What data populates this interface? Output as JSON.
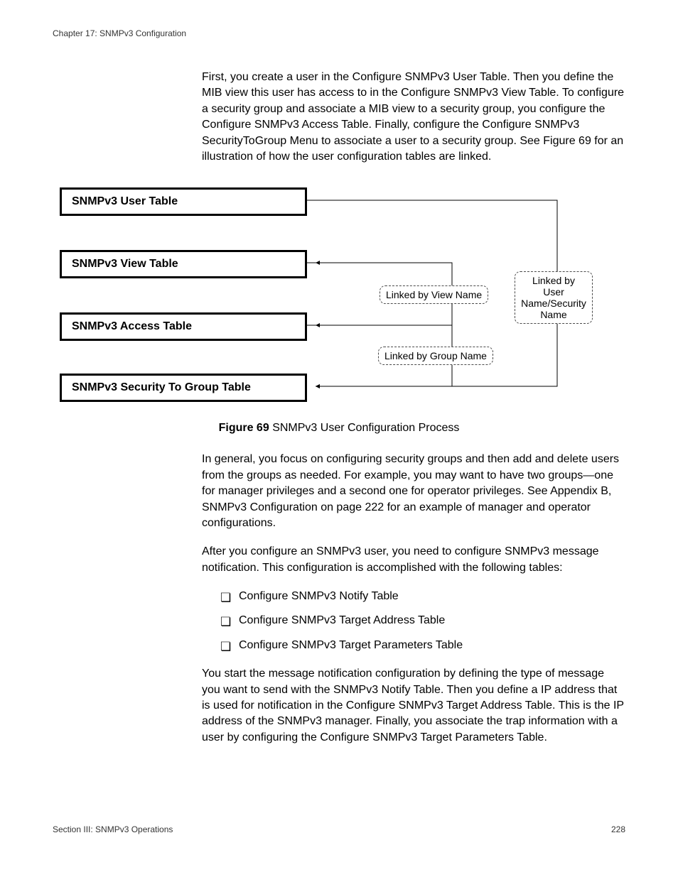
{
  "header": {
    "chapter": "Chapter 17: SNMPv3 Configuration"
  },
  "para1": "First, you create a user in the Configure SNMPv3 User Table. Then you define the MIB view this user has access to in the Configure SNMPv3 View Table. To configure a security group and associate a MIB view to a security group, you configure the Configure SNMPv3 Access Table. Finally, configure the Configure SNMPv3 SecurityToGroup Menu to associate a user to a security group. See Figure 69 for an illustration of how the user configuration tables are linked.",
  "diagram": {
    "tables": {
      "user": "SNMPv3 User Table",
      "view": "SNMPv3 View Table",
      "access": "SNMPv3 Access Table",
      "s2g": "SNMPv3 Security To Group Table"
    },
    "links": {
      "view_name": "Linked by View Name",
      "group_name": "Linked by Group Name",
      "user_sec": "Linked by User Name/Security Name"
    }
  },
  "figure": {
    "label": "Figure 69",
    "caption": "SNMPv3 User Configuration Process"
  },
  "para2": "In general, you focus on configuring security groups and then add and delete users from the groups as needed. For example, you may want to have two groups—one for manager privileges and a second one for operator privileges. See Appendix B, SNMPv3 Configuration on page 222 for an example of manager and operator configurations.",
  "para3": "After you configure an SNMPv3 user, you need to configure SNMPv3 message notification. This configuration is accomplished with the following tables:",
  "bullets": [
    "Configure SNMPv3 Notify Table",
    "Configure SNMPv3 Target Address Table",
    "Configure SNMPv3 Target Parameters Table"
  ],
  "para4": "You start the message notification configuration by defining the type of message you want to send with the SNMPv3 Notify Table. Then you define a IP address that is used for notification in the Configure SNMPv3 Target Address Table. This is the IP address of the SNMPv3 manager. Finally, you associate the trap information with a user by configuring the Configure SNMPv3 Target Parameters Table.",
  "footer": {
    "section": "Section III: SNMPv3 Operations",
    "page": "228"
  }
}
